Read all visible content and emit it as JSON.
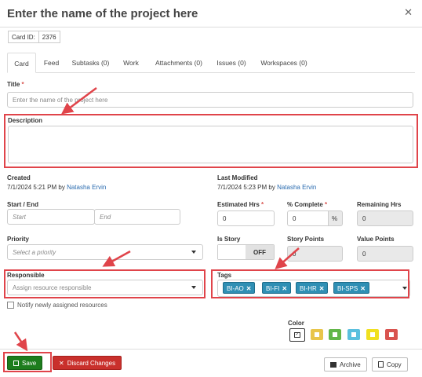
{
  "dialog": {
    "title": "Enter the name of the project here"
  },
  "card": {
    "id_label": "Card ID:",
    "id_value": "2376"
  },
  "tabs": [
    {
      "label": "Card"
    },
    {
      "label": "Feed"
    },
    {
      "label": "Subtasks (0)"
    },
    {
      "label": "Work"
    },
    {
      "label": "Attachments (0)"
    },
    {
      "label": "Issues (0)"
    },
    {
      "label": "Workspaces (0)"
    }
  ],
  "fields": {
    "title_label": "Title",
    "title_placeholder": "Enter the name of the project here",
    "description_label": "Description",
    "created_label": "Created",
    "created_value": "7/1/2024 5:21 PM by",
    "created_by": "Natasha Ervin",
    "modified_label": "Last Modified",
    "modified_value": "7/1/2024 5:23 PM by",
    "modified_by": "Natasha Ervin",
    "start_end_label": "Start / End",
    "start_placeholder": "Start",
    "end_placeholder": "End",
    "est_hrs_label": "Estimated Hrs",
    "est_hrs_value": "0",
    "pct_complete_label": "% Complete",
    "pct_complete_value": "0",
    "pct_symbol": "%",
    "remaining_label": "Remaining Hrs",
    "remaining_value": "0",
    "priority_label": "Priority",
    "priority_placeholder": "Select a priority",
    "is_story_label": "Is Story",
    "is_story_value": "OFF",
    "story_points_label": "Story Points",
    "story_points_value": "0",
    "value_points_label": "Value Points",
    "value_points_value": "0",
    "responsible_label": "Responsible",
    "responsible_placeholder": "Assign resource responsible",
    "tags_label": "Tags",
    "tags": [
      "BI-AO",
      "BI-FI",
      "BI-HR",
      "BI-SPS"
    ],
    "notify_label": "Notify newly assigned resources",
    "color_label": "Color"
  },
  "colors": [
    "#ffffff",
    "#e8c54a",
    "#62b64a",
    "#5bc0de",
    "#f0e020",
    "#d9534f"
  ],
  "buttons": {
    "save": "Save",
    "discard": "Discard Changes",
    "archive": "Archive",
    "copy": "Copy"
  },
  "icons": {
    "close": "close-icon",
    "save": "floppy-icon",
    "discard": "x-icon",
    "archive": "archive-icon",
    "copy": "copy-icon",
    "tag_remove": "x-icon"
  }
}
